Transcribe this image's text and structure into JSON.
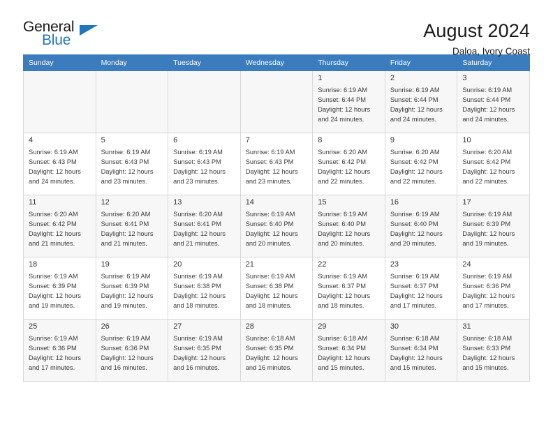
{
  "logo": {
    "word_one": "General",
    "word_two": "Blue",
    "accent_color": "#1f77bd",
    "triangle_icon": "triangle-icon"
  },
  "header": {
    "title": "August 2024",
    "subtitle": "Daloa, Ivory Coast"
  },
  "calendar": {
    "header_bg": "#3a7cbe",
    "weekday_headers": [
      "Sunday",
      "Monday",
      "Tuesday",
      "Wednesday",
      "Thursday",
      "Friday",
      "Saturday"
    ],
    "labels": {
      "sunrise_prefix": "Sunrise:",
      "sunset_prefix": "Sunset:",
      "daylight_prefix": "Daylight:"
    },
    "weeks": [
      [
        {
          "day": "",
          "sunrise": "",
          "sunset": "",
          "daylight_line1": "",
          "daylight_line2": ""
        },
        {
          "day": "",
          "sunrise": "",
          "sunset": "",
          "daylight_line1": "",
          "daylight_line2": ""
        },
        {
          "day": "",
          "sunrise": "",
          "sunset": "",
          "daylight_line1": "",
          "daylight_line2": ""
        },
        {
          "day": "",
          "sunrise": "",
          "sunset": "",
          "daylight_line1": "",
          "daylight_line2": ""
        },
        {
          "day": "1",
          "sunrise": "Sunrise: 6:19 AM",
          "sunset": "Sunset: 6:44 PM",
          "daylight_line1": "Daylight: 12 hours",
          "daylight_line2": "and 24 minutes."
        },
        {
          "day": "2",
          "sunrise": "Sunrise: 6:19 AM",
          "sunset": "Sunset: 6:44 PM",
          "daylight_line1": "Daylight: 12 hours",
          "daylight_line2": "and 24 minutes."
        },
        {
          "day": "3",
          "sunrise": "Sunrise: 6:19 AM",
          "sunset": "Sunset: 6:44 PM",
          "daylight_line1": "Daylight: 12 hours",
          "daylight_line2": "and 24 minutes."
        }
      ],
      [
        {
          "day": "4",
          "sunrise": "Sunrise: 6:19 AM",
          "sunset": "Sunset: 6:43 PM",
          "daylight_line1": "Daylight: 12 hours",
          "daylight_line2": "and 24 minutes."
        },
        {
          "day": "5",
          "sunrise": "Sunrise: 6:19 AM",
          "sunset": "Sunset: 6:43 PM",
          "daylight_line1": "Daylight: 12 hours",
          "daylight_line2": "and 23 minutes."
        },
        {
          "day": "6",
          "sunrise": "Sunrise: 6:19 AM",
          "sunset": "Sunset: 6:43 PM",
          "daylight_line1": "Daylight: 12 hours",
          "daylight_line2": "and 23 minutes."
        },
        {
          "day": "7",
          "sunrise": "Sunrise: 6:19 AM",
          "sunset": "Sunset: 6:43 PM",
          "daylight_line1": "Daylight: 12 hours",
          "daylight_line2": "and 23 minutes."
        },
        {
          "day": "8",
          "sunrise": "Sunrise: 6:20 AM",
          "sunset": "Sunset: 6:42 PM",
          "daylight_line1": "Daylight: 12 hours",
          "daylight_line2": "and 22 minutes."
        },
        {
          "day": "9",
          "sunrise": "Sunrise: 6:20 AM",
          "sunset": "Sunset: 6:42 PM",
          "daylight_line1": "Daylight: 12 hours",
          "daylight_line2": "and 22 minutes."
        },
        {
          "day": "10",
          "sunrise": "Sunrise: 6:20 AM",
          "sunset": "Sunset: 6:42 PM",
          "daylight_line1": "Daylight: 12 hours",
          "daylight_line2": "and 22 minutes."
        }
      ],
      [
        {
          "day": "11",
          "sunrise": "Sunrise: 6:20 AM",
          "sunset": "Sunset: 6:42 PM",
          "daylight_line1": "Daylight: 12 hours",
          "daylight_line2": "and 21 minutes."
        },
        {
          "day": "12",
          "sunrise": "Sunrise: 6:20 AM",
          "sunset": "Sunset: 6:41 PM",
          "daylight_line1": "Daylight: 12 hours",
          "daylight_line2": "and 21 minutes."
        },
        {
          "day": "13",
          "sunrise": "Sunrise: 6:20 AM",
          "sunset": "Sunset: 6:41 PM",
          "daylight_line1": "Daylight: 12 hours",
          "daylight_line2": "and 21 minutes."
        },
        {
          "day": "14",
          "sunrise": "Sunrise: 6:19 AM",
          "sunset": "Sunset: 6:40 PM",
          "daylight_line1": "Daylight: 12 hours",
          "daylight_line2": "and 20 minutes."
        },
        {
          "day": "15",
          "sunrise": "Sunrise: 6:19 AM",
          "sunset": "Sunset: 6:40 PM",
          "daylight_line1": "Daylight: 12 hours",
          "daylight_line2": "and 20 minutes."
        },
        {
          "day": "16",
          "sunrise": "Sunrise: 6:19 AM",
          "sunset": "Sunset: 6:40 PM",
          "daylight_line1": "Daylight: 12 hours",
          "daylight_line2": "and 20 minutes."
        },
        {
          "day": "17",
          "sunrise": "Sunrise: 6:19 AM",
          "sunset": "Sunset: 6:39 PM",
          "daylight_line1": "Daylight: 12 hours",
          "daylight_line2": "and 19 minutes."
        }
      ],
      [
        {
          "day": "18",
          "sunrise": "Sunrise: 6:19 AM",
          "sunset": "Sunset: 6:39 PM",
          "daylight_line1": "Daylight: 12 hours",
          "daylight_line2": "and 19 minutes."
        },
        {
          "day": "19",
          "sunrise": "Sunrise: 6:19 AM",
          "sunset": "Sunset: 6:39 PM",
          "daylight_line1": "Daylight: 12 hours",
          "daylight_line2": "and 19 minutes."
        },
        {
          "day": "20",
          "sunrise": "Sunrise: 6:19 AM",
          "sunset": "Sunset: 6:38 PM",
          "daylight_line1": "Daylight: 12 hours",
          "daylight_line2": "and 18 minutes."
        },
        {
          "day": "21",
          "sunrise": "Sunrise: 6:19 AM",
          "sunset": "Sunset: 6:38 PM",
          "daylight_line1": "Daylight: 12 hours",
          "daylight_line2": "and 18 minutes."
        },
        {
          "day": "22",
          "sunrise": "Sunrise: 6:19 AM",
          "sunset": "Sunset: 6:37 PM",
          "daylight_line1": "Daylight: 12 hours",
          "daylight_line2": "and 18 minutes."
        },
        {
          "day": "23",
          "sunrise": "Sunrise: 6:19 AM",
          "sunset": "Sunset: 6:37 PM",
          "daylight_line1": "Daylight: 12 hours",
          "daylight_line2": "and 17 minutes."
        },
        {
          "day": "24",
          "sunrise": "Sunrise: 6:19 AM",
          "sunset": "Sunset: 6:36 PM",
          "daylight_line1": "Daylight: 12 hours",
          "daylight_line2": "and 17 minutes."
        }
      ],
      [
        {
          "day": "25",
          "sunrise": "Sunrise: 6:19 AM",
          "sunset": "Sunset: 6:36 PM",
          "daylight_line1": "Daylight: 12 hours",
          "daylight_line2": "and 17 minutes."
        },
        {
          "day": "26",
          "sunrise": "Sunrise: 6:19 AM",
          "sunset": "Sunset: 6:36 PM",
          "daylight_line1": "Daylight: 12 hours",
          "daylight_line2": "and 16 minutes."
        },
        {
          "day": "27",
          "sunrise": "Sunrise: 6:19 AM",
          "sunset": "Sunset: 6:35 PM",
          "daylight_line1": "Daylight: 12 hours",
          "daylight_line2": "and 16 minutes."
        },
        {
          "day": "28",
          "sunrise": "Sunrise: 6:18 AM",
          "sunset": "Sunset: 6:35 PM",
          "daylight_line1": "Daylight: 12 hours",
          "daylight_line2": "and 16 minutes."
        },
        {
          "day": "29",
          "sunrise": "Sunrise: 6:18 AM",
          "sunset": "Sunset: 6:34 PM",
          "daylight_line1": "Daylight: 12 hours",
          "daylight_line2": "and 15 minutes."
        },
        {
          "day": "30",
          "sunrise": "Sunrise: 6:18 AM",
          "sunset": "Sunset: 6:34 PM",
          "daylight_line1": "Daylight: 12 hours",
          "daylight_line2": "and 15 minutes."
        },
        {
          "day": "31",
          "sunrise": "Sunrise: 6:18 AM",
          "sunset": "Sunset: 6:33 PM",
          "daylight_line1": "Daylight: 12 hours",
          "daylight_line2": "and 15 minutes."
        }
      ]
    ]
  }
}
